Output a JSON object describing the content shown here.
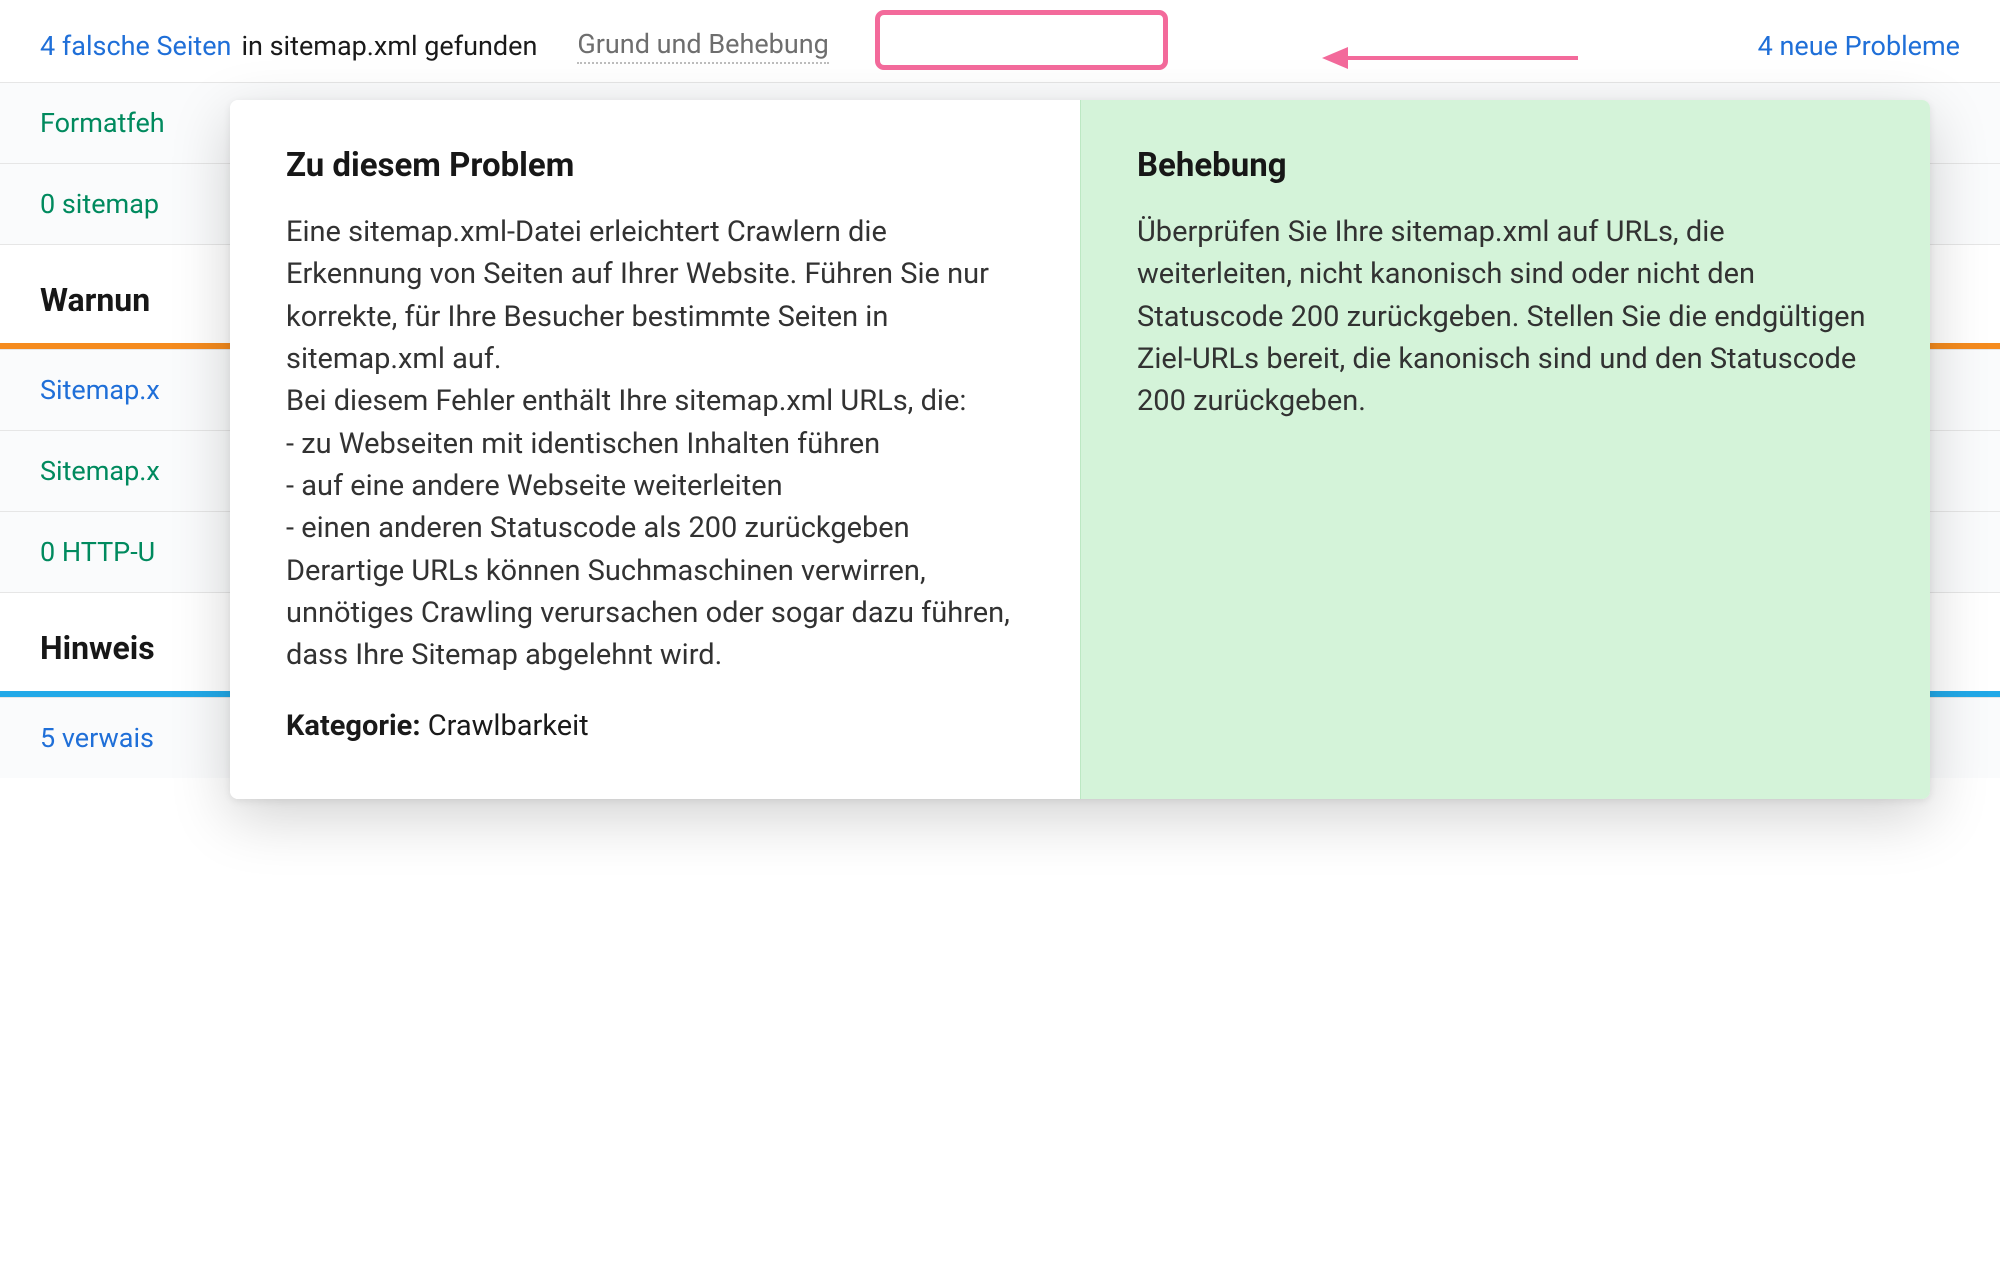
{
  "top": {
    "issue_count_link": "4 falsche Seiten",
    "issue_suffix": " in sitemap.xml gefunden",
    "why_fix_label": "Grund und Behebung",
    "new_issues": "4 neue Probleme"
  },
  "rows": {
    "r1": "Formatfeh",
    "r2": "0 sitemap",
    "header_warn": "Warnun",
    "r3": "Sitemap.x",
    "r4": "Sitemap.x",
    "r5": "0 HTTP-U",
    "header_info": "Hinweis",
    "r6": "5 verwais"
  },
  "popover": {
    "left_title": "Zu diesem Problem",
    "para1": "Eine sitemap.xml-Datei erleichtert Crawlern die Erkennung von Seiten auf Ihrer Website. Führen Sie nur korrekte, für Ihre Besucher bestimmte Seiten in sitemap.xml auf.",
    "para2": "Bei diesem Fehler enthält Ihre sitemap.xml URLs, die:",
    "bullet1": "- zu Webseiten mit identischen Inhalten führen",
    "bullet2": "- auf eine andere Webseite weiterleiten",
    "bullet3": "- einen anderen Statuscode als 200 zurückgeben",
    "para3": "Derartige URLs können Suchmaschinen verwirren, unnötiges Crawling verursachen oder sogar dazu führen, dass Ihre Sitemap abgelehnt wird.",
    "category_label": "Kategorie:",
    "category_value": " Crawlbarkeit",
    "right_title": "Behebung",
    "right_body": "Überprüfen Sie Ihre sitemap.xml auf URLs, die weiterleiten, nicht kanonisch sind oder nicht den Statuscode 200 zurückgeben. Stellen Sie die endgültigen Ziel-URLs bereit, die kanonisch sind und den Statuscode 200 zurückgeben."
  },
  "colors": {
    "accent_blue": "#1f6fd8",
    "accent_green_text": "#008a5e",
    "warn_orange": "#f58b1e",
    "info_blue": "#22a9e8",
    "highlight_pink": "#f36a9b",
    "fix_bg": "#d4f3d9"
  }
}
